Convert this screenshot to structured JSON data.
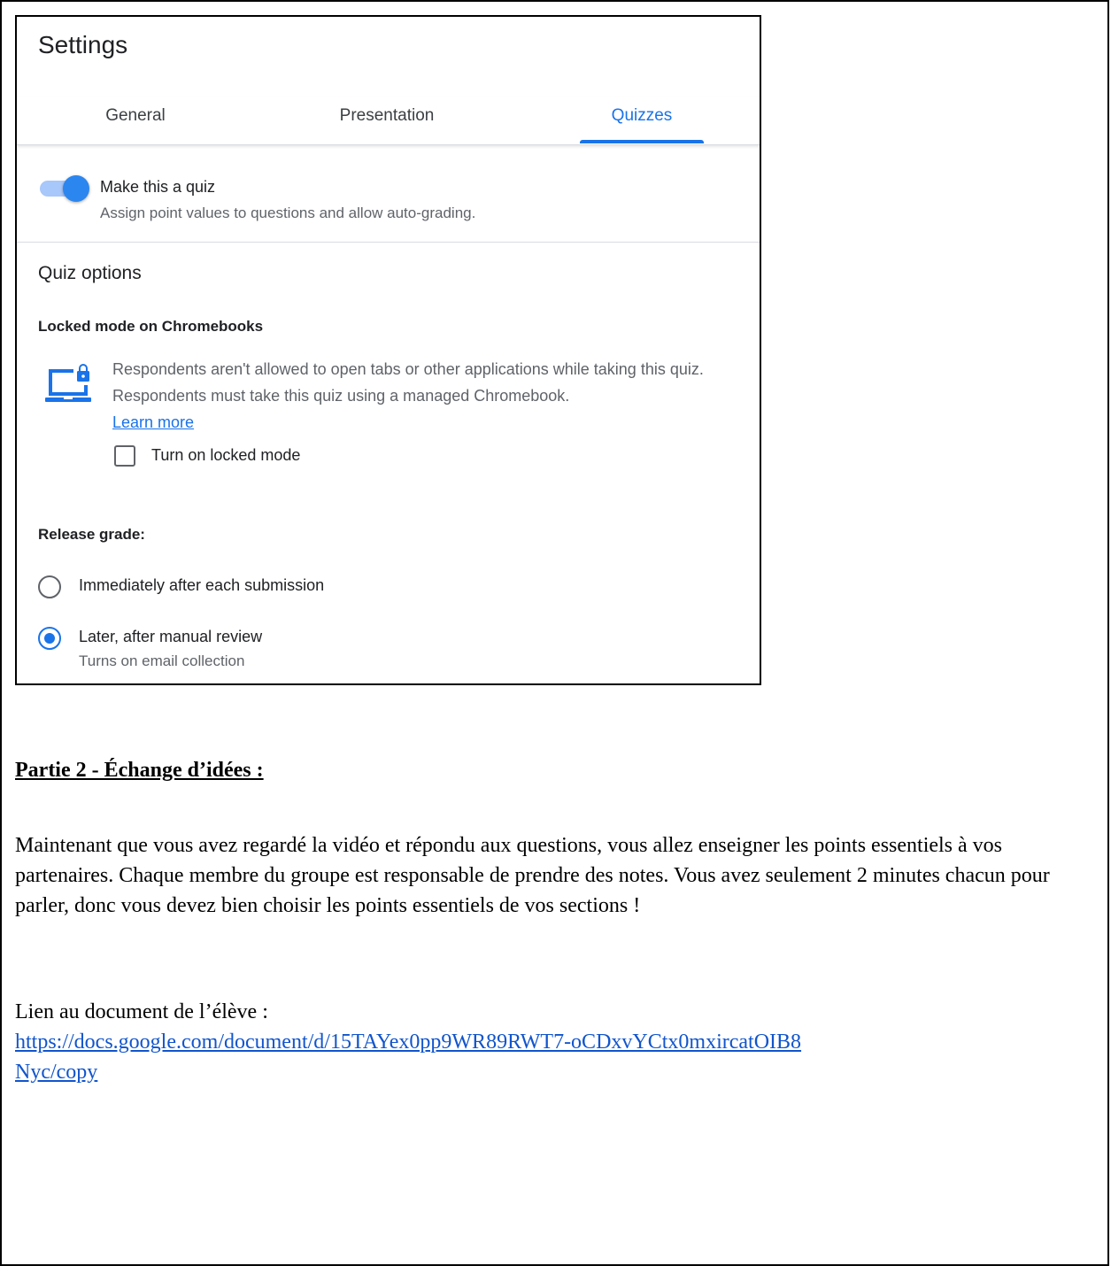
{
  "settings": {
    "title": "Settings",
    "tabs": [
      {
        "label": "General",
        "active": false
      },
      {
        "label": "Presentation",
        "active": false
      },
      {
        "label": "Quizzes",
        "active": true
      }
    ],
    "quiz_toggle": {
      "label": "Make this a quiz",
      "description": "Assign point values to questions and allow auto-grading.",
      "on": true
    },
    "quiz_options_title": "Quiz options",
    "locked_mode": {
      "heading": "Locked mode on Chromebooks",
      "icon": "chromebook-lock-icon",
      "description": "Respondents aren't allowed to open tabs or other applications while taking this quiz. Respondents must take this quiz using a managed Chromebook.",
      "learn_more": "Learn more",
      "checkbox_label": "Turn on locked mode",
      "checked": false
    },
    "release_grade": {
      "heading": "Release grade:",
      "options": [
        {
          "label": "Immediately after each submission",
          "selected": false
        },
        {
          "label": "Later, after manual review",
          "selected": true,
          "sublabel": "Turns on email collection"
        }
      ]
    },
    "colors": {
      "accent": "#1a73e8",
      "toggle_track": "#a8c7fa",
      "muted_text": "#5f6368"
    }
  },
  "document": {
    "part_heading": "Partie 2 - Échange d’idées :",
    "paragraph": "Maintenant que vous avez regardé la vidéo et répondu aux questions, vous allez enseigner les points essentiels à vos partenaires. Chaque membre du groupe est responsable de prendre des notes. Vous avez seulement 2 minutes chacun pour parler, donc vous devez bien choisir les points essentiels de vos sections !",
    "link_label": "Lien au document de l’élève :",
    "link_url": "https://docs.google.com/document/d/15TAYex0pp9WR89RWT7-oCDxvYCtx0mxircatOIB8Nyc/copy"
  }
}
